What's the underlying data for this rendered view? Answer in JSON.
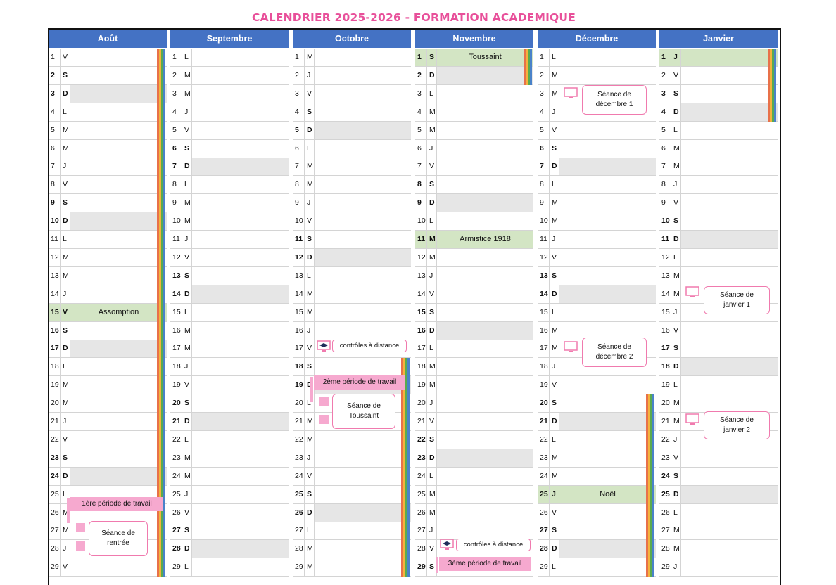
{
  "title": "CALENDRIER 2025-2026 - FORMATION ACADEMIQUE",
  "months": [
    {
      "name": "Août",
      "first_dow": 4,
      "holidays": {
        "15": "Assomption"
      }
    },
    {
      "name": "Septembre",
      "first_dow": 0,
      "holidays": {}
    },
    {
      "name": "Octobre",
      "first_dow": 2,
      "holidays": {}
    },
    {
      "name": "Novembre",
      "first_dow": 5,
      "holidays": {
        "1": "Toussaint",
        "11": "Armistice 1918"
      }
    },
    {
      "name": "Décembre",
      "first_dow": 0,
      "holidays": {
        "25": "Noël"
      }
    },
    {
      "name": "Janvier",
      "first_dow": 3,
      "holidays": {
        "1": ""
      }
    }
  ],
  "day_letters": [
    "L",
    "M",
    "M",
    "J",
    "V",
    "S",
    "D"
  ],
  "visible_days": 29,
  "events": {
    "aout_banner": "1ère période de travail",
    "aout_callout": "Séance de rentrée",
    "oct_ctrl": "contrôles à distance",
    "oct_banner": "2ème période de travail",
    "oct_callout": "Séance de Toussaint",
    "nov_ctrl": "contrôles à distance",
    "nov_banner": "3ème période de travail",
    "dec_callout1": "Séance de décembre 1",
    "dec_callout2": "Séance de décembre 2",
    "jan_callout1": "Séance de janvier 1",
    "jan_callout2": "Séance de janvier 2"
  },
  "colors": {
    "header_blue": "#4472c4",
    "title_pink": "#e8509a",
    "holiday_green": "#d3e5c4",
    "weekend_gray": "#e6e6e6",
    "stripe_colors": [
      "#e8714a",
      "#f3b33d",
      "#5aab4f",
      "#4a82c9"
    ]
  }
}
